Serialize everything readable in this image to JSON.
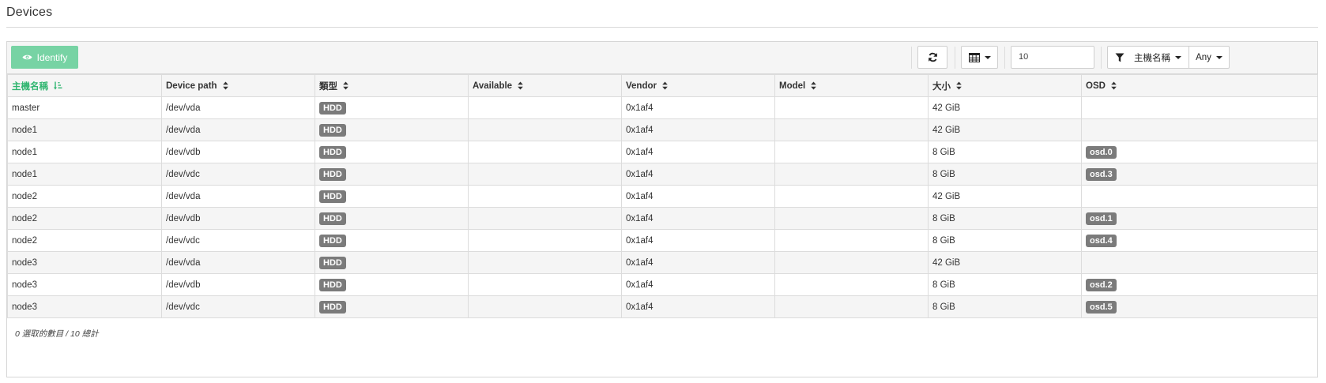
{
  "page": {
    "title": "Devices"
  },
  "toolbar": {
    "identify_label": "Identify",
    "page_size_value": "10",
    "filter_label": "主機名稱",
    "filter_value": "Any"
  },
  "table": {
    "columns": [
      "主機名稱",
      "Device path",
      "類型",
      "Available",
      "Vendor",
      "Model",
      "大小",
      "OSD"
    ],
    "sorted_column": "主機名稱",
    "rows": [
      {
        "hostname": "master",
        "path": "/dev/vda",
        "type": "HDD",
        "available": "",
        "vendor": "0x1af4",
        "model": "",
        "size": "42 GiB",
        "osd": ""
      },
      {
        "hostname": "node1",
        "path": "/dev/vda",
        "type": "HDD",
        "available": "",
        "vendor": "0x1af4",
        "model": "",
        "size": "42 GiB",
        "osd": ""
      },
      {
        "hostname": "node1",
        "path": "/dev/vdb",
        "type": "HDD",
        "available": "",
        "vendor": "0x1af4",
        "model": "",
        "size": "8 GiB",
        "osd": "osd.0"
      },
      {
        "hostname": "node1",
        "path": "/dev/vdc",
        "type": "HDD",
        "available": "",
        "vendor": "0x1af4",
        "model": "",
        "size": "8 GiB",
        "osd": "osd.3"
      },
      {
        "hostname": "node2",
        "path": "/dev/vda",
        "type": "HDD",
        "available": "",
        "vendor": "0x1af4",
        "model": "",
        "size": "42 GiB",
        "osd": ""
      },
      {
        "hostname": "node2",
        "path": "/dev/vdb",
        "type": "HDD",
        "available": "",
        "vendor": "0x1af4",
        "model": "",
        "size": "8 GiB",
        "osd": "osd.1"
      },
      {
        "hostname": "node2",
        "path": "/dev/vdc",
        "type": "HDD",
        "available": "",
        "vendor": "0x1af4",
        "model": "",
        "size": "8 GiB",
        "osd": "osd.4"
      },
      {
        "hostname": "node3",
        "path": "/dev/vda",
        "type": "HDD",
        "available": "",
        "vendor": "0x1af4",
        "model": "",
        "size": "42 GiB",
        "osd": ""
      },
      {
        "hostname": "node3",
        "path": "/dev/vdb",
        "type": "HDD",
        "available": "",
        "vendor": "0x1af4",
        "model": "",
        "size": "8 GiB",
        "osd": "osd.2"
      },
      {
        "hostname": "node3",
        "path": "/dev/vdc",
        "type": "HDD",
        "available": "",
        "vendor": "0x1af4",
        "model": "",
        "size": "8 GiB",
        "osd": "osd.5"
      }
    ]
  },
  "footer": {
    "selection_summary": "0 選取的數目 / 10 總計"
  },
  "icons": {
    "identify": "eye-icon",
    "refresh": "refresh-icon",
    "columns": "table-columns-icon",
    "filter": "filter-icon",
    "sort_active": "sort-ascending-icon",
    "sort": "sort-icon"
  },
  "colors": {
    "accent": "#2fb56f",
    "identify_button": "#77d3a4",
    "badge": "#7b7b7b",
    "toolbar_bg": "#f5f5f5"
  }
}
